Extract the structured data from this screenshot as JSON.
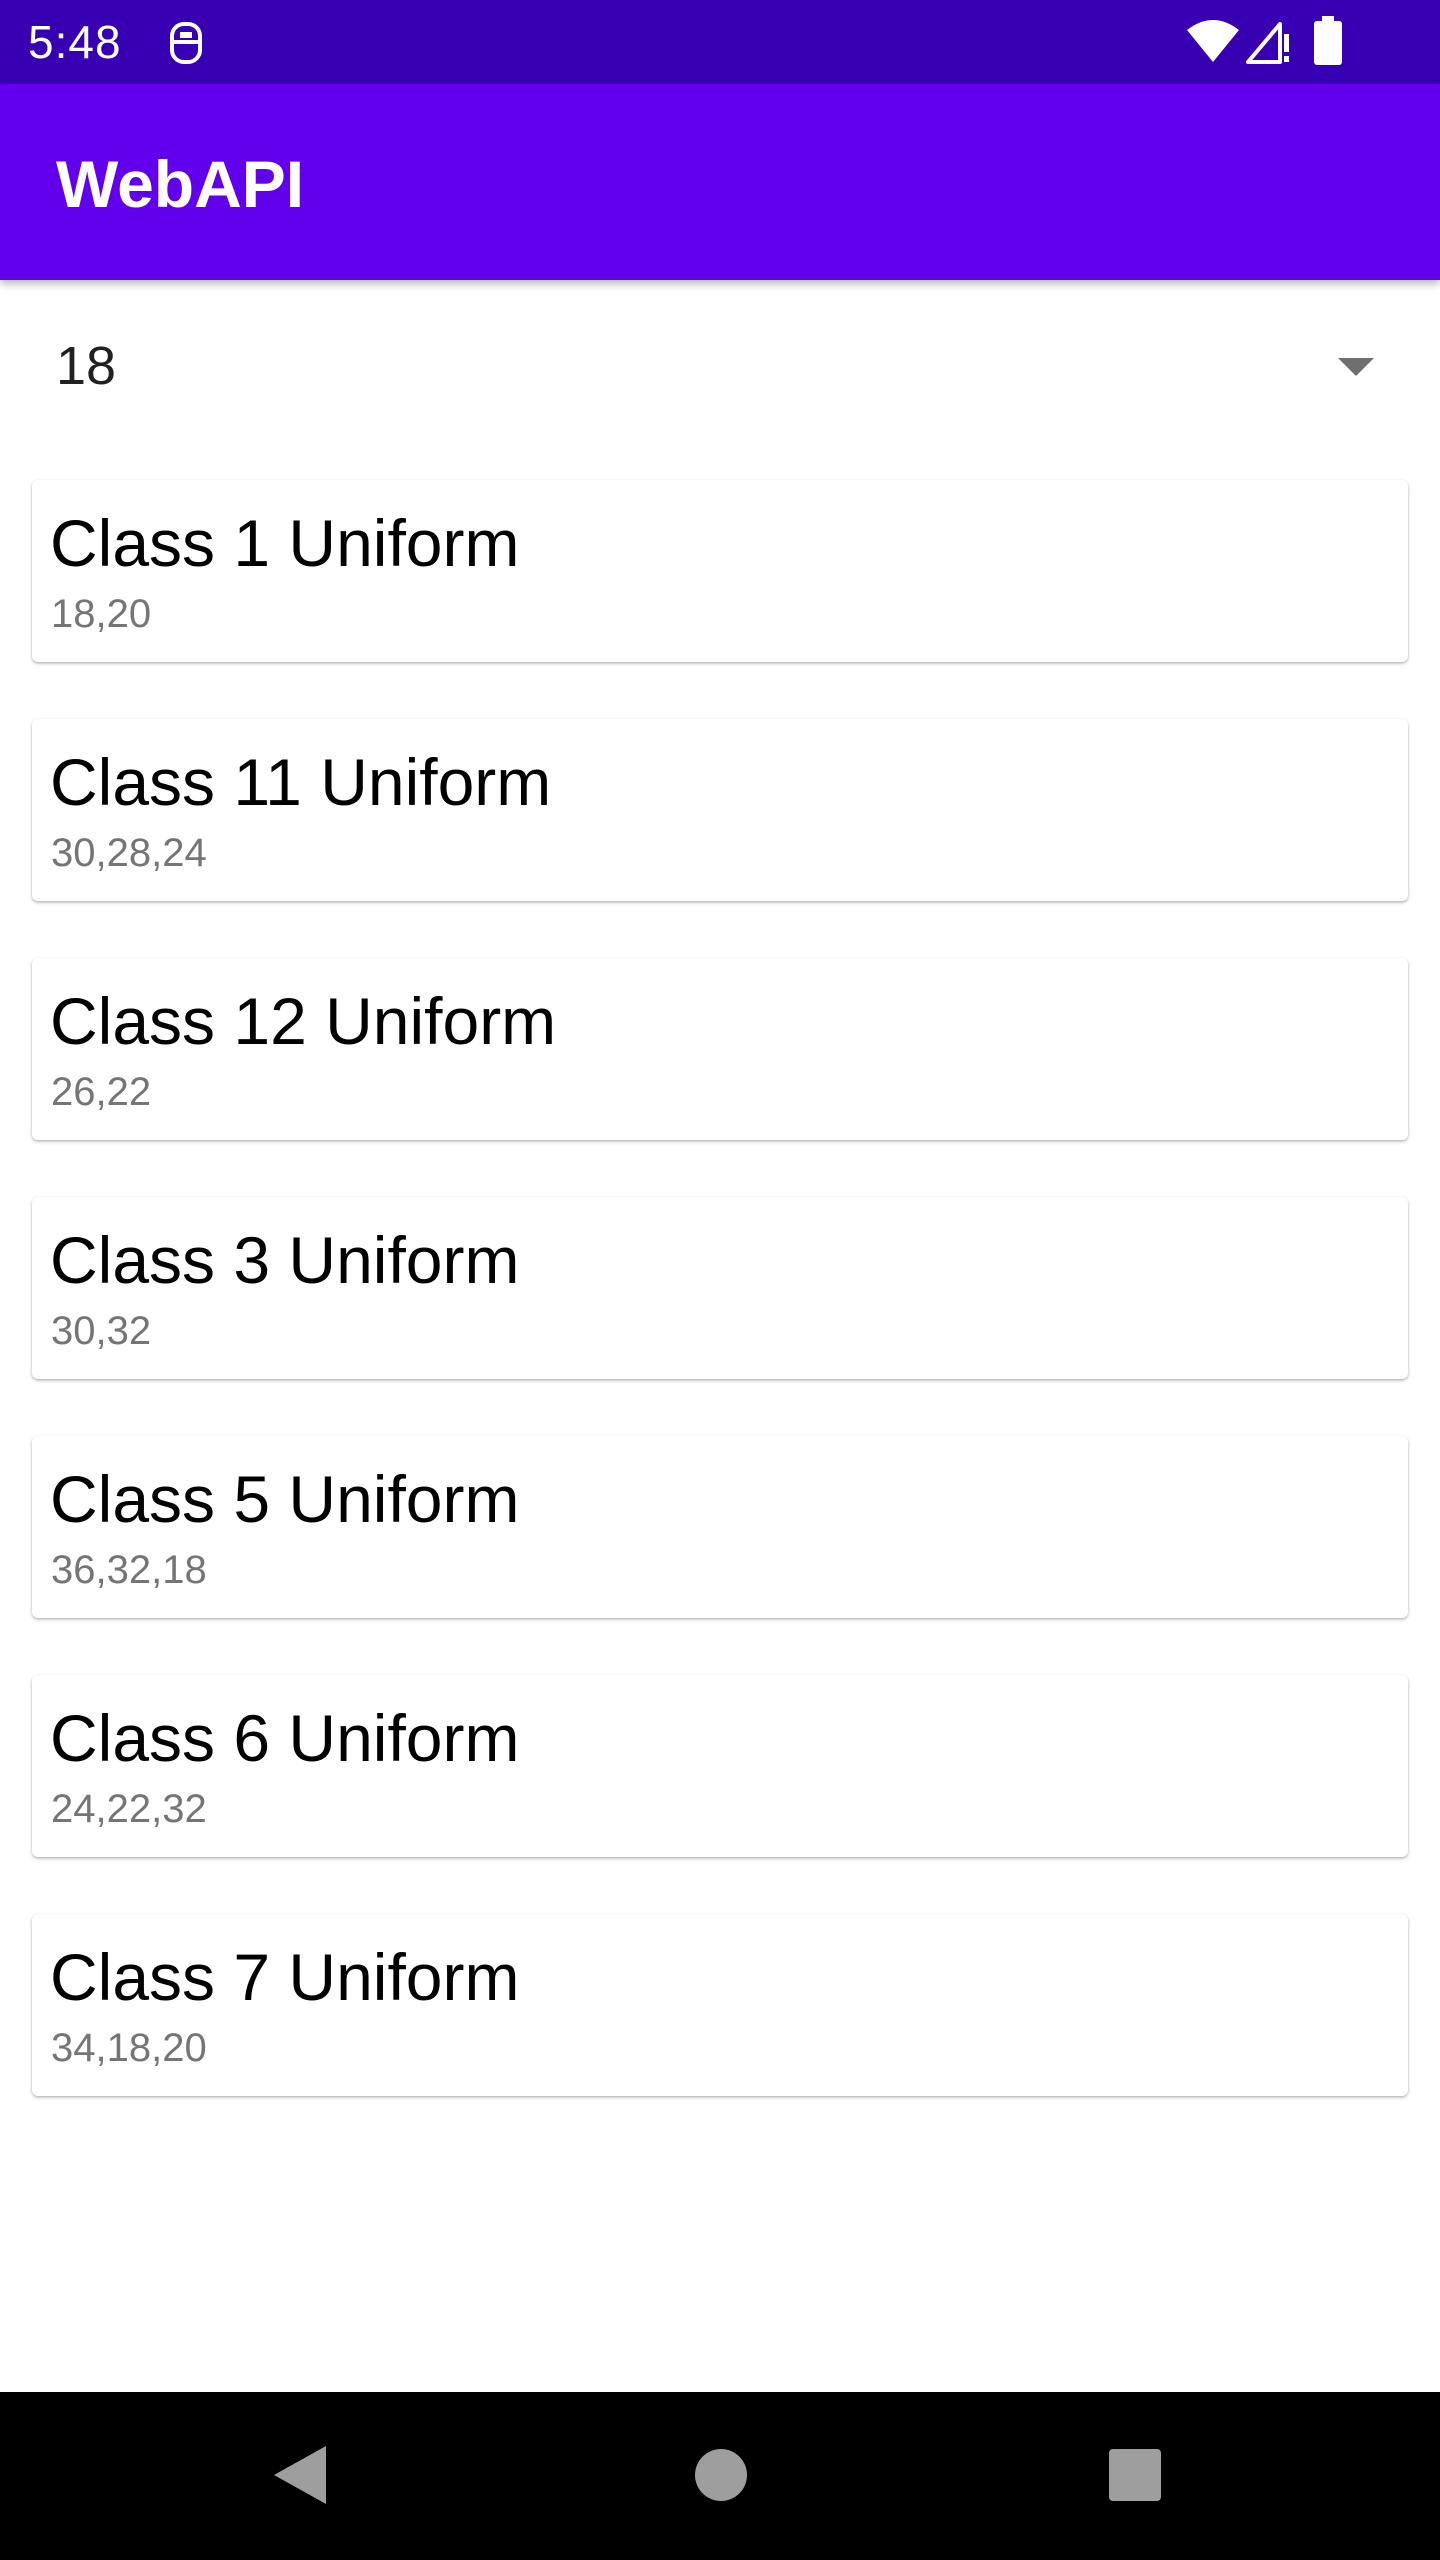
{
  "status_bar": {
    "time": "5:48",
    "icons": [
      "notification-app-icon",
      "wifi-icon",
      "signal-icon",
      "battery-icon"
    ]
  },
  "app_bar": {
    "title": "WebAPI",
    "color": "#6200ee",
    "status_color": "#3700b3"
  },
  "spinner": {
    "selected_value": "18"
  },
  "list": {
    "items": [
      {
        "title": "Class 1 Uniform",
        "sizes": "18,20"
      },
      {
        "title": "Class 11 Uniform",
        "sizes": "30,28,24"
      },
      {
        "title": "Class 12 Uniform",
        "sizes": "26,22"
      },
      {
        "title": "Class 3 Uniform",
        "sizes": "30,32"
      },
      {
        "title": "Class 5 Uniform",
        "sizes": "36,32,18"
      },
      {
        "title": "Class 6 Uniform",
        "sizes": "24,22,32"
      },
      {
        "title": "Class 7 Uniform",
        "sizes": "34,18,20"
      }
    ]
  },
  "nav_bar": {
    "buttons": [
      "back-icon",
      "home-icon",
      "recents-icon"
    ]
  }
}
